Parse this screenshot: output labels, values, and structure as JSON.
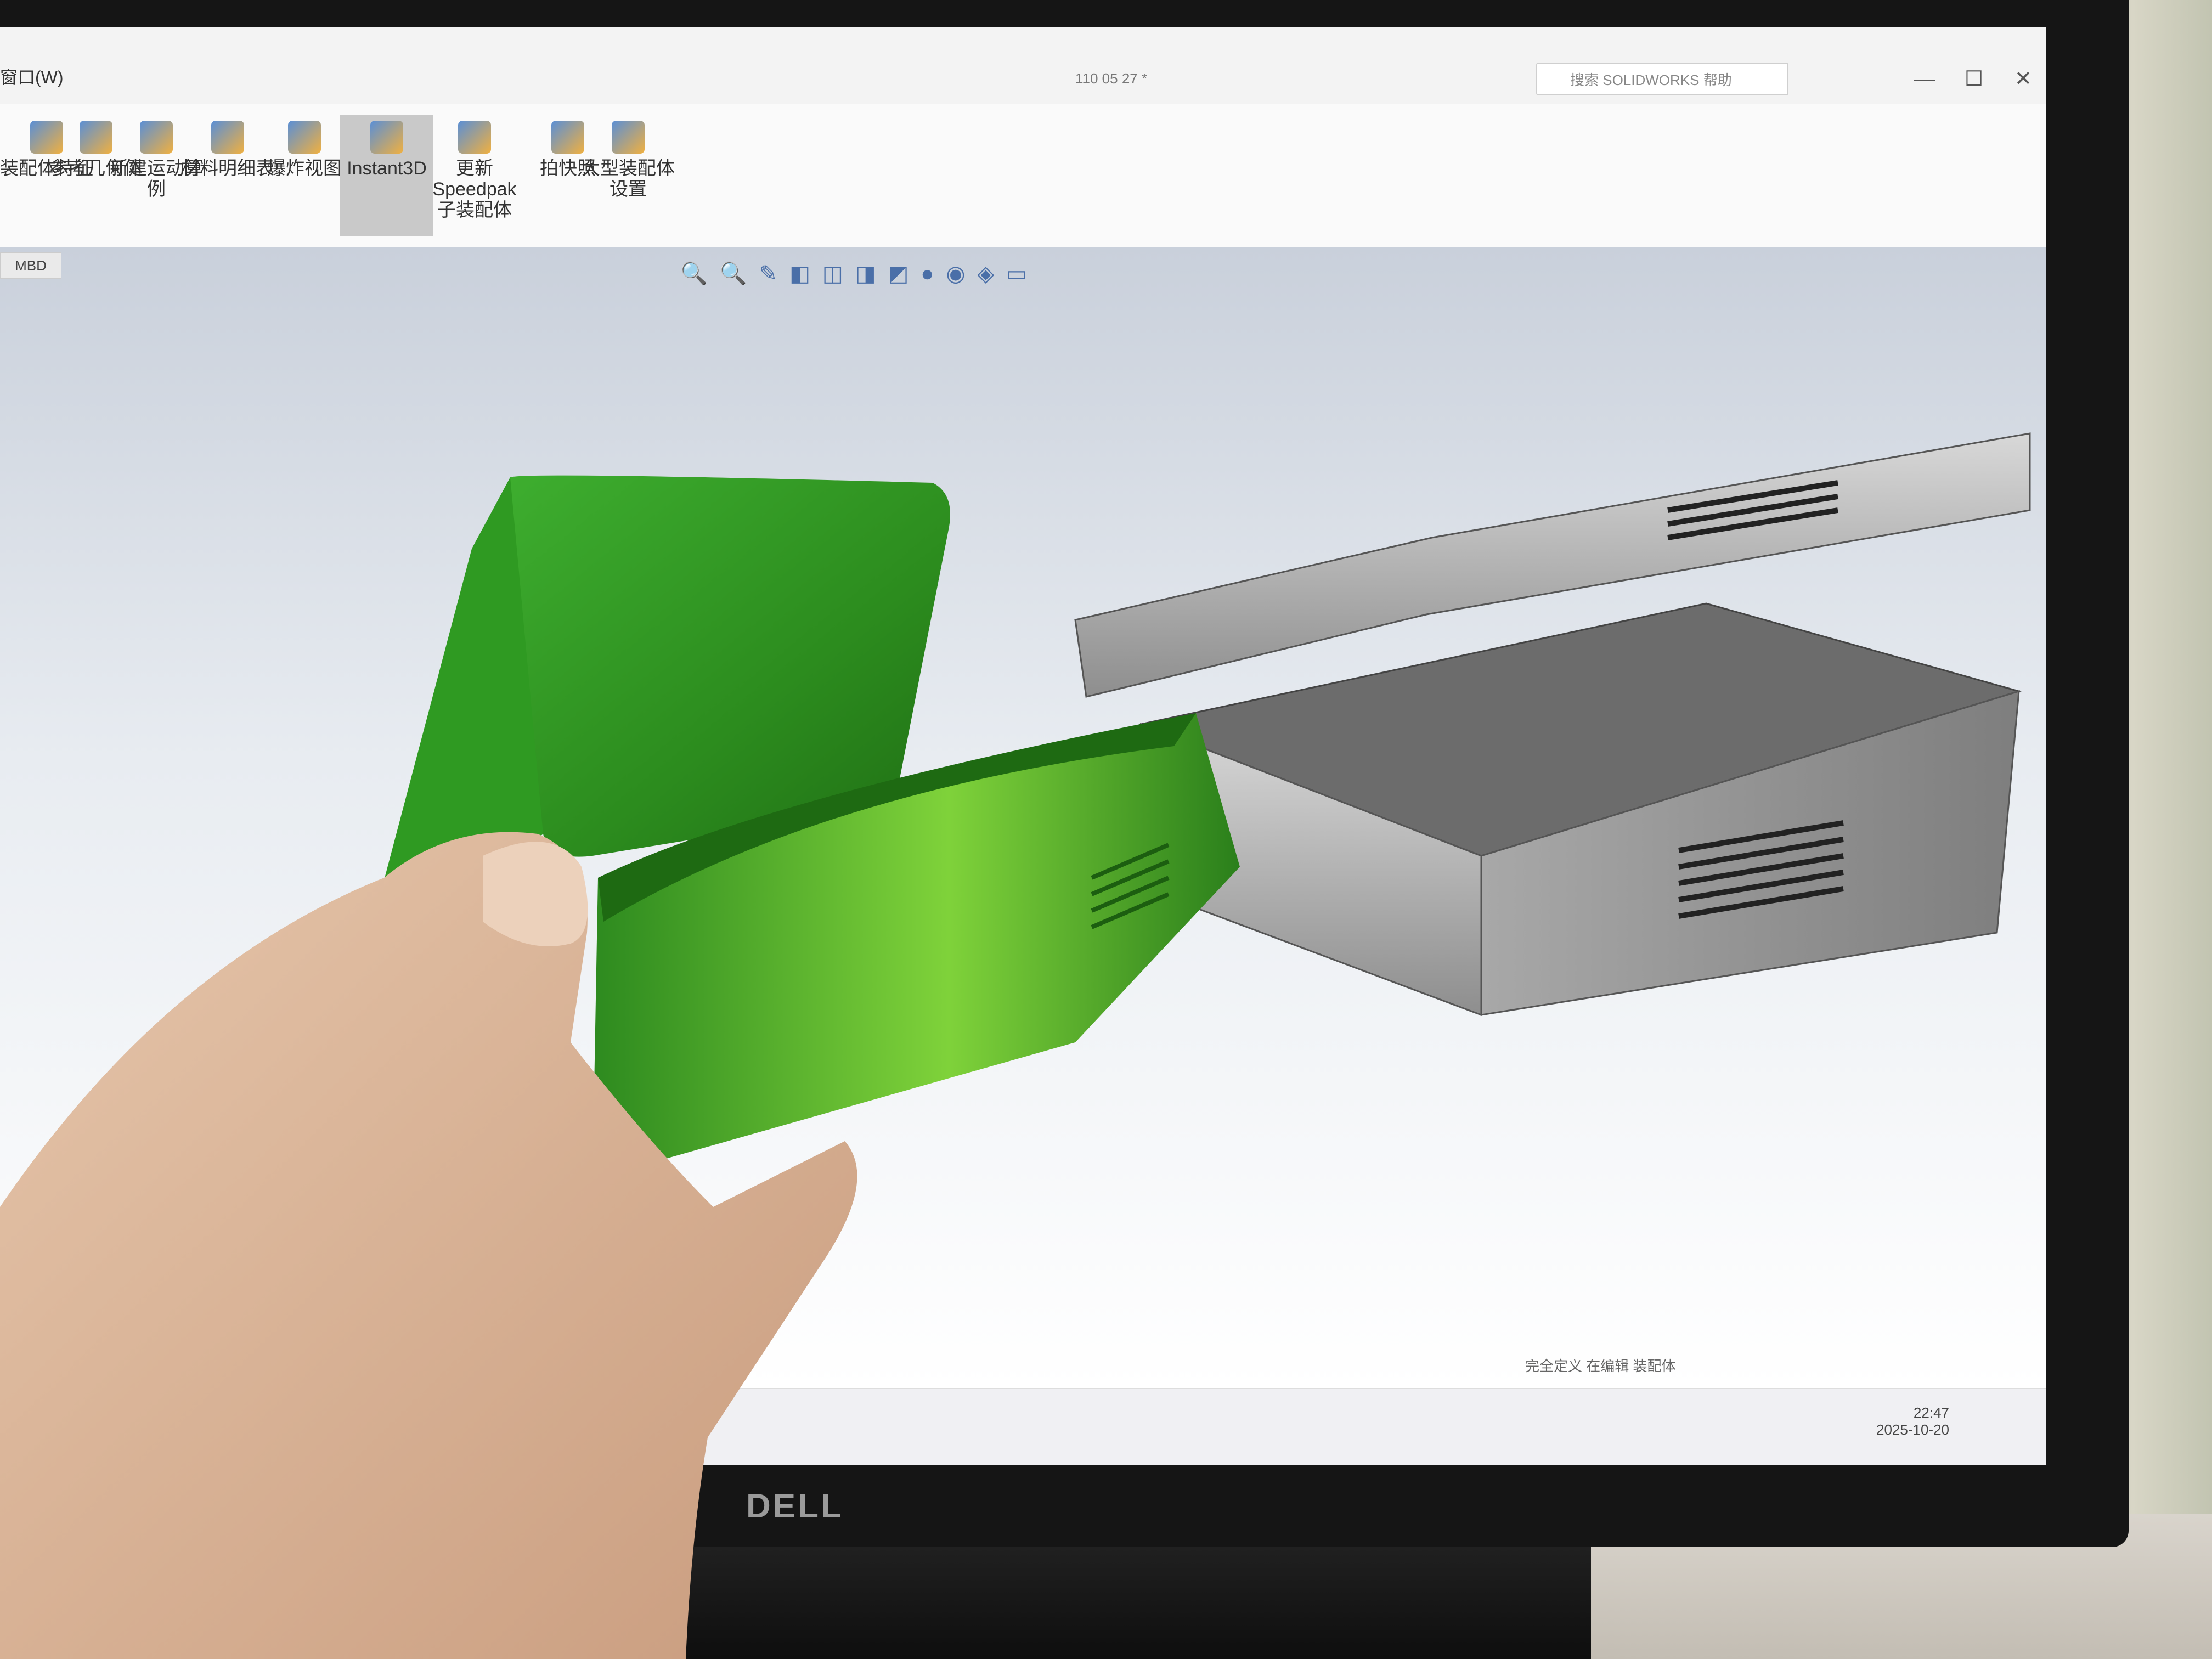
{
  "window": {
    "menu_label": "窗口(W)",
    "doc_title": "110 05 27 *",
    "search_placeholder": "搜索 SOLIDWORKS 帮助",
    "controls": [
      "—",
      "☐",
      "✕"
    ]
  },
  "ribbon": {
    "items": [
      {
        "label": "装配体特征"
      },
      {
        "label": "参考几何体"
      },
      {
        "label": "新建运动算例"
      },
      {
        "label": "材料明细表"
      },
      {
        "label": "爆炸视图"
      },
      {
        "label": "Instant3D",
        "active": true
      },
      {
        "label": "更新 Speedpak 子装配体"
      },
      {
        "label": "拍快照"
      },
      {
        "label": "大型装配体设置"
      }
    ]
  },
  "tabs": {
    "mbd": "MBD"
  },
  "statusbar": {
    "text": "完全定义  在编辑 装配体"
  },
  "taskbar": {
    "time": "22:47",
    "date": "2025-10-20"
  },
  "monitor": {
    "brand": "DELL"
  },
  "colors": {
    "print_green": "#2f9a22",
    "cad_gray": "#9a9a9a",
    "skin": "#e2bfa3"
  }
}
